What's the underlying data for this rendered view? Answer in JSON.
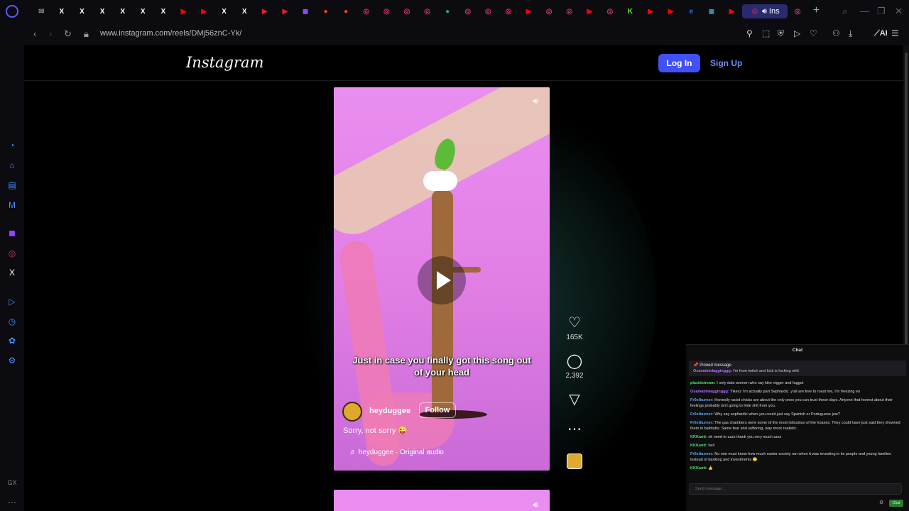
{
  "browser": {
    "url": "www.instagram.com/reels/DMj56znC-Yk/",
    "active_tab_label": "Ins",
    "tab_favicons": [
      {
        "icon": "mail-icon",
        "color": "#888888",
        "glyph": "✉"
      },
      {
        "icon": "x-icon",
        "color": "#ffffff",
        "glyph": "X"
      },
      {
        "icon": "x-icon",
        "color": "#ffffff",
        "glyph": "X"
      },
      {
        "icon": "x-icon",
        "color": "#ffffff",
        "glyph": "X"
      },
      {
        "icon": "x-icon",
        "color": "#ffffff",
        "glyph": "X"
      },
      {
        "icon": "x-icon",
        "color": "#ffffff",
        "glyph": "X"
      },
      {
        "icon": "x-icon",
        "color": "#ffffff",
        "glyph": "X"
      },
      {
        "icon": "youtube-icon",
        "color": "#ff0000",
        "glyph": "▶"
      },
      {
        "icon": "youtube-icon",
        "color": "#ff0000",
        "glyph": "▶"
      },
      {
        "icon": "x-icon",
        "color": "#ffffff",
        "glyph": "X"
      },
      {
        "icon": "x-icon",
        "color": "#ffffff",
        "glyph": "X"
      },
      {
        "icon": "flag-icon",
        "color": "#e02020",
        "glyph": "▶"
      },
      {
        "icon": "flag-icon",
        "color": "#e02020",
        "glyph": "▶"
      },
      {
        "icon": "twitch-icon",
        "color": "#9146ff",
        "glyph": "◼"
      },
      {
        "icon": "reddit-icon",
        "color": "#ff4500",
        "glyph": "●"
      },
      {
        "icon": "reddit-icon",
        "color": "#ff4500",
        "glyph": "●"
      },
      {
        "icon": "instagram-icon",
        "color": "#e1306c",
        "glyph": "◎"
      },
      {
        "icon": "instagram-icon",
        "color": "#e1306c",
        "glyph": "◎"
      },
      {
        "icon": "instagram-icon",
        "color": "#e1306c",
        "glyph": "◎"
      },
      {
        "icon": "instagram-icon",
        "color": "#e1306c",
        "glyph": "◎"
      },
      {
        "icon": "chrome-icon",
        "color": "#34a853",
        "glyph": "●"
      },
      {
        "icon": "instagram-icon",
        "color": "#e1306c",
        "glyph": "◎"
      },
      {
        "icon": "instagram-icon",
        "color": "#e1306c",
        "glyph": "◎"
      },
      {
        "icon": "instagram-icon",
        "color": "#e1306c",
        "glyph": "◎"
      },
      {
        "icon": "youtube-icon",
        "color": "#ff0000",
        "glyph": "▶"
      },
      {
        "icon": "instagram-icon",
        "color": "#e1306c",
        "glyph": "◎"
      },
      {
        "icon": "instagram-icon",
        "color": "#e1306c",
        "glyph": "◎"
      },
      {
        "icon": "youtube-icon",
        "color": "#ff0000",
        "glyph": "▶"
      },
      {
        "icon": "instagram-icon",
        "color": "#e1306c",
        "glyph": "◎"
      },
      {
        "icon": "kick-icon",
        "color": "#53fc18",
        "glyph": "K"
      },
      {
        "icon": "youtube-icon",
        "color": "#ff0000",
        "glyph": "▶"
      },
      {
        "icon": "youtube-icon",
        "color": "#ff0000",
        "glyph": "▶"
      },
      {
        "icon": "edge-icon",
        "color": "#1f7ae0",
        "glyph": "e"
      },
      {
        "icon": "app-icon",
        "color": "#3a8ab0",
        "glyph": "◼"
      },
      {
        "icon": "youtube-icon",
        "color": "#ff0000",
        "glyph": "▶"
      }
    ]
  },
  "instagram": {
    "logo": "Instagram",
    "login_label": "Log In",
    "signup_label": "Sign Up",
    "reel": {
      "caption": "Just in case you finally got this song out of your head",
      "username": "heyduggee",
      "follow_label": "Follow",
      "description": "Sorry, not sorry 😜",
      "audio": "♬ heyduggee · Original audio"
    },
    "actions": {
      "likes": "165K",
      "comments": "2,392"
    }
  },
  "chat": {
    "title": "Chat",
    "pinned_header": "Pinned message",
    "pinned_user": "Osamabinlagginggg:",
    "pinned_text": " I'm from twitch and kick is fucking wild",
    "messages": [
      {
        "user": "placidstream:",
        "style": "grn",
        "text": " I only date women who say kike nigger and faggot"
      },
      {
        "user": "Osamabinlagginggg:",
        "style": "alt",
        "text": " Yikesz I'm actually part Sephardic. y'all are free to roast me, I'm freezing en"
      },
      {
        "user": "Fr0stburner:",
        "style": "",
        "text": " Honestly racist chicks are about the only ones you can trust these days. Anyone that honest about their feelings probably isn't going to hide shit from you."
      },
      {
        "user": "Fr0stburner:",
        "style": "",
        "text": " Why say sephardic when you could just say Spanish or Portuguese jew?"
      },
      {
        "user": "Fr0stburner:",
        "style": "",
        "text": " The gas chambers were some of the most ridiculous of the hoaxes. They could have just said they drowned them in bathtubs. Same fear and suffering, way more realistic."
      },
      {
        "user": "KKKantt:",
        "style": "grn",
        "text": " ok need to zzzz thank you very much zzzz"
      },
      {
        "user": "KKKantt:",
        "style": "grn",
        "text": " hell"
      },
      {
        "user": "Fr0stburner:",
        "style": "",
        "text": " No one must know how much easier society ran when it was investing in its people and young families instead of banking and investments 🙁"
      },
      {
        "user": "KKKantt:",
        "style": "grn",
        "text": " 👍"
      }
    ],
    "input_placeholder": "Send message...",
    "send_label": "Chat"
  }
}
